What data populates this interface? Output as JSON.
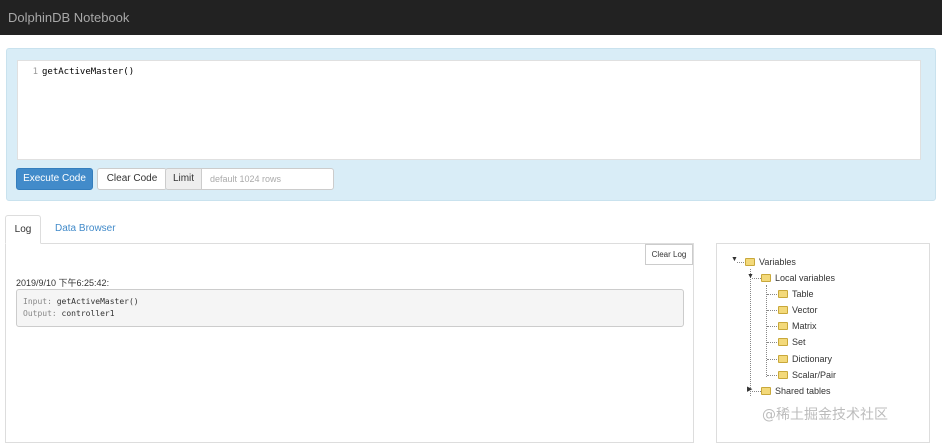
{
  "app": {
    "title": "DolphinDB Notebook"
  },
  "editor": {
    "line_number": "1",
    "code": "getActiveMaster()"
  },
  "toolbar": {
    "execute_label": "Execute Code",
    "clear_label": "Clear Code",
    "limit_label": "Limit",
    "limit_placeholder": "default 1024 rows",
    "limit_value": ""
  },
  "tabs": [
    {
      "label": "Log",
      "active": true
    },
    {
      "label": "Data Browser",
      "active": false
    }
  ],
  "log": {
    "clear_label": "Clear Log",
    "timestamp": "2019/9/10 下午6:25:42:",
    "input_key": "Input:",
    "input_value": "getActiveMaster()",
    "output_key": "Output:",
    "output_value": "controller1"
  },
  "variables": {
    "root": "Variables",
    "local": "Local variables",
    "local_items": [
      "Table",
      "Vector",
      "Matrix",
      "Set",
      "Dictionary",
      "Scalar/Pair"
    ],
    "shared": "Shared tables"
  },
  "watermark": "@稀土掘金技术社区",
  "colors": {
    "topbar": "#222222",
    "panel": "#d9edf7",
    "primary": "#428bca"
  }
}
